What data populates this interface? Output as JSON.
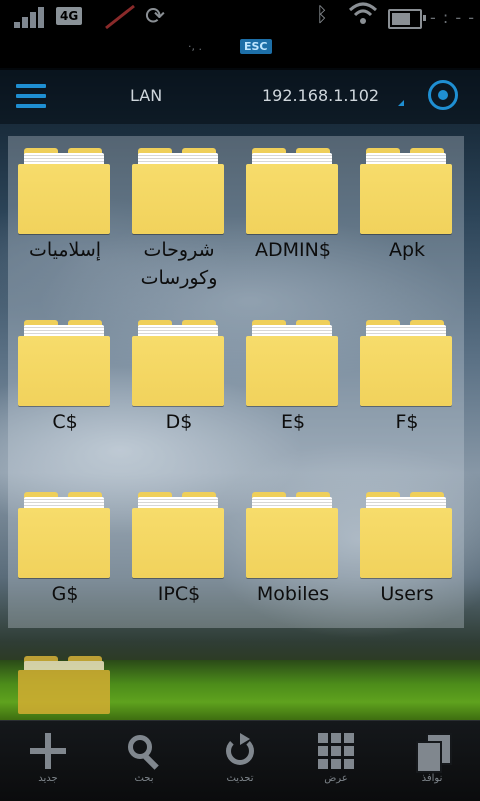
{
  "statusbar": {
    "network_type": "4G",
    "badge_text": "ESC",
    "note_text": "·,  .",
    "clock": "- : - -"
  },
  "toolbar": {
    "crumbs": [
      "LAN",
      "192.168.1.102"
    ]
  },
  "folders": [
    {
      "label": "Apk"
    },
    {
      "label": "ADMIN$"
    },
    {
      "label": "شروحات وكورسات"
    },
    {
      "label": "إسلاميات"
    },
    {
      "label": "F$"
    },
    {
      "label": "E$"
    },
    {
      "label": "D$"
    },
    {
      "label": "C$"
    },
    {
      "label": "Users"
    },
    {
      "label": "Mobiles"
    },
    {
      "label": "IPC$"
    },
    {
      "label": "G$"
    }
  ],
  "bottombar": {
    "buttons": [
      {
        "label": "جديد",
        "icon": "plus-icon"
      },
      {
        "label": "بحث",
        "icon": "search-icon"
      },
      {
        "label": "تحديث",
        "icon": "refresh-icon"
      },
      {
        "label": "عرض",
        "icon": "grid-icon"
      },
      {
        "label": "نوافذ",
        "icon": "windows-icon"
      }
    ]
  },
  "colors": {
    "accent": "#1f8fd2",
    "folder": "#f1d25c",
    "label": "#0d0d0d"
  }
}
